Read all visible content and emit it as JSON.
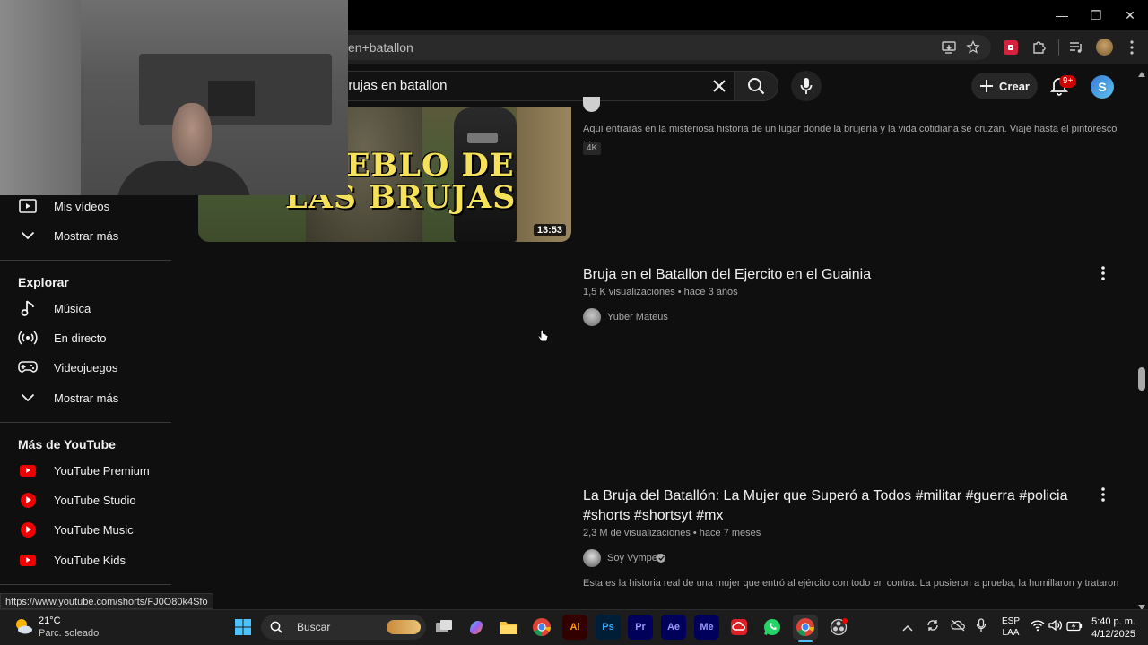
{
  "browser": {
    "address_text": "en+batallon",
    "window_controls": {
      "minimize": "—",
      "restore": "❐",
      "close": "✕"
    }
  },
  "header": {
    "search_query": "brujas en batallon",
    "create_label": "Crear",
    "notification_count": "9+",
    "avatar_letter": "S"
  },
  "sidebar": {
    "top_items": [
      {
        "label": "Mis vídeos",
        "icon": "play-square-icon"
      },
      {
        "label": "Mostrar más",
        "icon": "chevron-down-icon"
      }
    ],
    "explore_title": "Explorar",
    "explore_items": [
      {
        "label": "Música",
        "icon": "music-note-icon"
      },
      {
        "label": "En directo",
        "icon": "live-icon"
      },
      {
        "label": "Videojuegos",
        "icon": "gamepad-icon"
      },
      {
        "label": "Mostrar más",
        "icon": "chevron-down-icon"
      }
    ],
    "more_title": "Más de YouTube",
    "more_items": [
      {
        "label": "YouTube Premium",
        "icon": "youtube-premium-icon"
      },
      {
        "label": "YouTube Studio",
        "icon": "youtube-studio-icon"
      },
      {
        "label": "YouTube Music",
        "icon": "youtube-music-icon"
      },
      {
        "label": "YouTube Kids",
        "icon": "youtube-kids-icon"
      }
    ]
  },
  "results": [
    {
      "thumb_text_1": "EBLO DE",
      "thumb_text_2": "LAS BRUJAS",
      "duration": "13:53",
      "description": "Aquí entrarás en la misteriosa historia de un lugar donde la brujería y la vida cotidiana se cruzan. Viajé hasta el pintoresco ...",
      "badge": "4K"
    },
    {
      "title": "Bruja en el Batallon del Ejercito en el Guainia",
      "meta": "1,5 K visualizaciones • hace 3 años",
      "channel": "Yuber Mateus"
    },
    {
      "title_line1": "La Bruja del Batallón: La Mujer que Superó a Todos #militar #guerra #policia",
      "title_line2": "#shorts #shortsyt #mx",
      "meta": "2,3 M de visualizaciones • hace 7 meses",
      "channel": "Soy Vympel",
      "description": "Esta es la historia real de una mujer que entró al ejército con todo en contra. La pusieron a prueba, la humillaron y trataron de ..."
    }
  ],
  "status_url": "https://www.youtube.com/shorts/FJ0O80k4Sfo",
  "taskbar": {
    "weather_temp": "21°C",
    "weather_desc": "Parc. soleado",
    "search_label": "Buscar",
    "lang_line1": "ESP",
    "lang_line2": "LAA",
    "time": "5:40 p. m.",
    "date": "4/12/2025"
  },
  "colors": {
    "background": "#0f0f0f",
    "youtube_red": "#ee0000",
    "notification_badge": "#cc0000"
  }
}
